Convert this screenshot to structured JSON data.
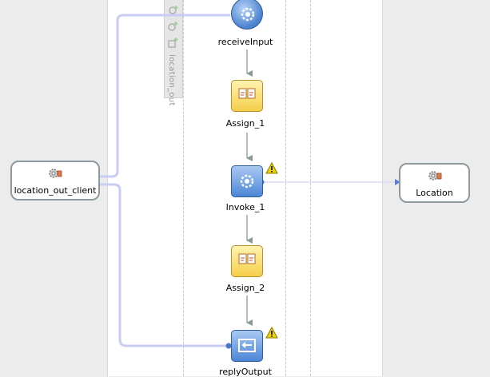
{
  "partner_links": {
    "client": {
      "label": "location_out_client",
      "icon": "gear-icon"
    },
    "service": {
      "label": "Location",
      "icon": "gear-icon"
    }
  },
  "variables_panel": {
    "label": "location_out"
  },
  "activities": {
    "receive": {
      "label": "receiveInput",
      "icon": "receive-icon"
    },
    "assign1": {
      "label": "Assign_1",
      "icon": "assign-icon"
    },
    "invoke": {
      "label": "Invoke_1",
      "icon": "invoke-icon",
      "warning": true
    },
    "assign2": {
      "label": "Assign_2",
      "icon": "assign-icon"
    },
    "reply": {
      "label": "replyOutput",
      "icon": "reply-icon",
      "warning": true
    }
  },
  "colors": {
    "wire": "#c9cdf3",
    "flow_arrow": "#8a9a94",
    "assign": "#f5cf4a",
    "invoke": "#4d86d6",
    "warning": "#f2d400"
  }
}
